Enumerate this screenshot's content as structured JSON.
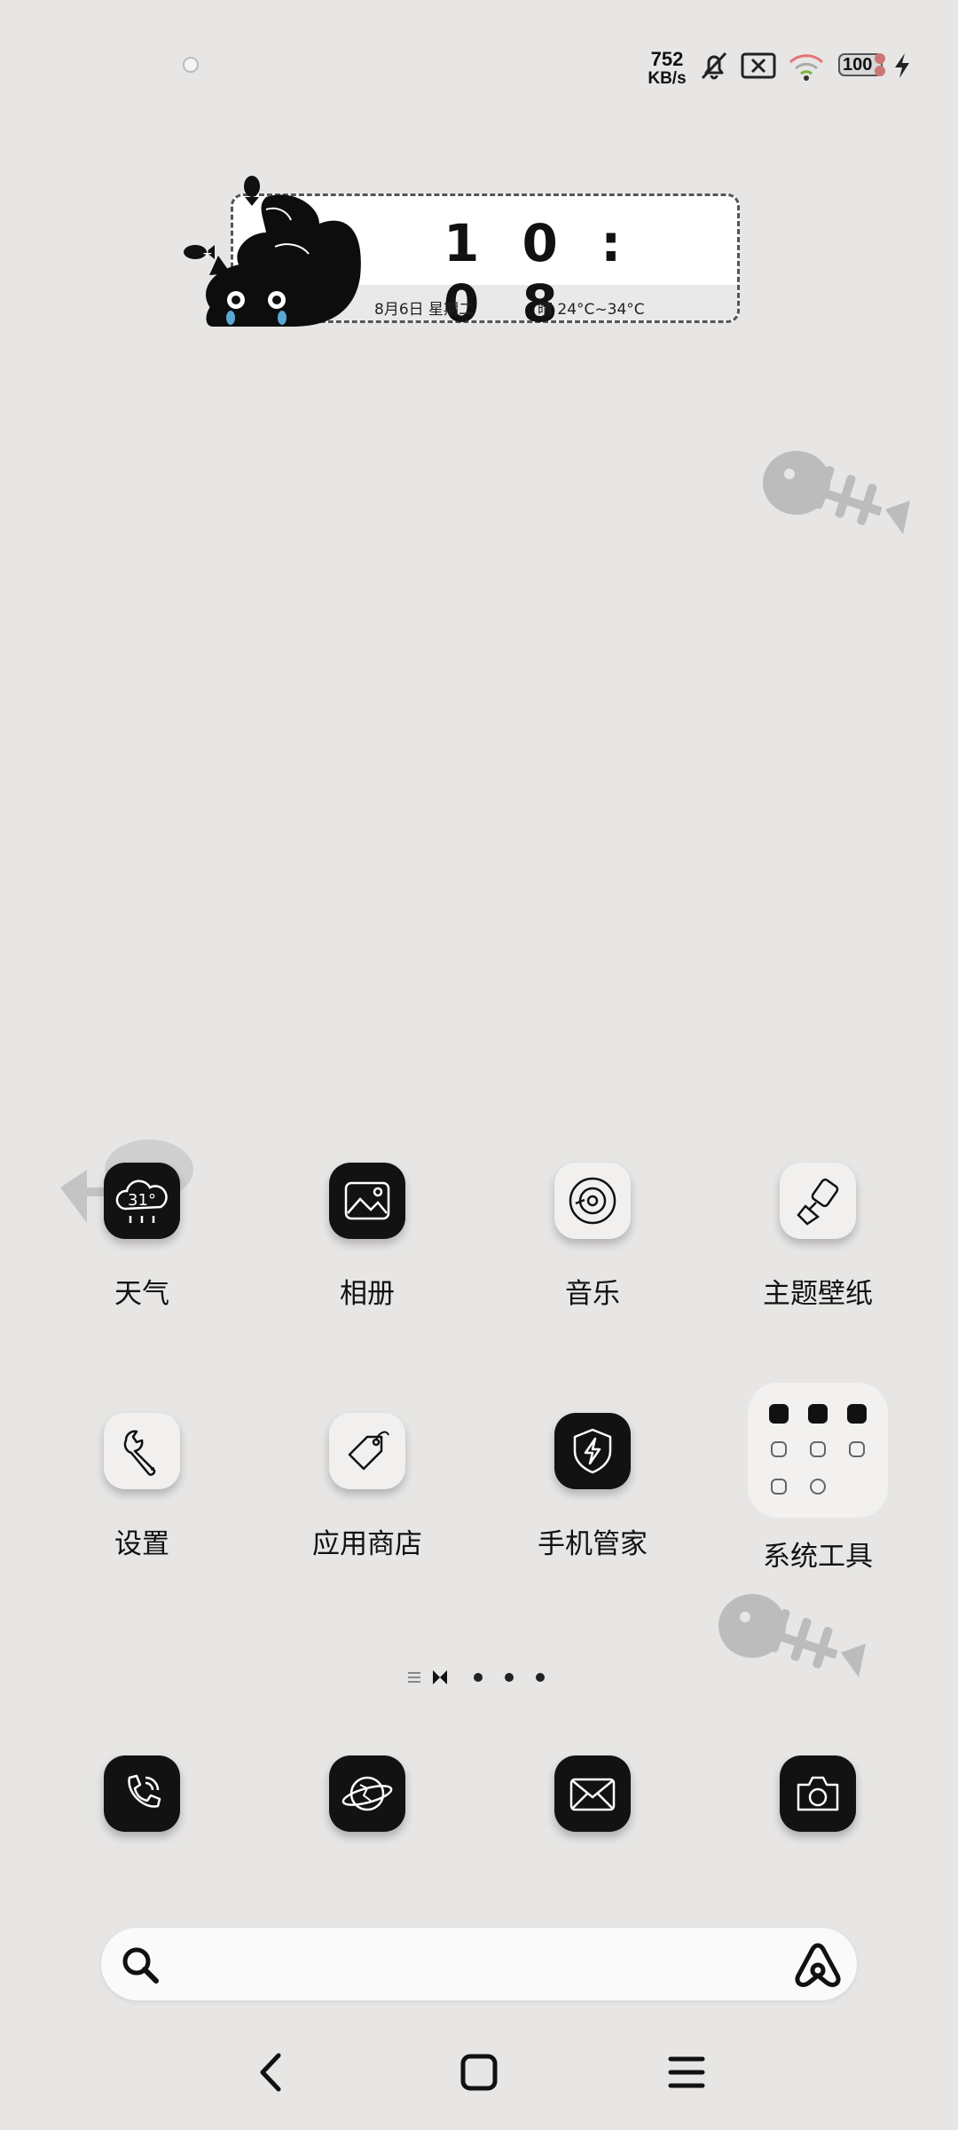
{
  "status_bar": {
    "net_speed_value": "752",
    "net_speed_unit": "KB/s",
    "battery_level": "100",
    "icons": [
      "notification-dot-icon",
      "mute-bell-icon",
      "no-sim-icon",
      "wifi-icon",
      "battery-icon",
      "charging-bolt-icon"
    ]
  },
  "clock_widget": {
    "time": "1 0 : 0 8",
    "date": "8月6日 星期二",
    "weather": "晴 24°C~34°C"
  },
  "apps": [
    {
      "label": "天气",
      "icon": "weather-cloud-icon",
      "badge": "31°"
    },
    {
      "label": "相册",
      "icon": "gallery-image-icon"
    },
    {
      "label": "音乐",
      "icon": "music-disc-icon"
    },
    {
      "label": "主题壁纸",
      "icon": "paint-brush-icon"
    },
    {
      "label": "设置",
      "icon": "wrench-icon"
    },
    {
      "label": "应用商店",
      "icon": "price-tag-icon"
    },
    {
      "label": "手机管家",
      "icon": "shield-bolt-icon"
    },
    {
      "label": "系统工具",
      "icon": "folder-icon"
    }
  ],
  "pager": {
    "current": 1,
    "total": 3
  },
  "dock": [
    {
      "icon": "phone-icon"
    },
    {
      "icon": "browser-globe-icon"
    },
    {
      "icon": "mail-icon"
    },
    {
      "icon": "camera-icon"
    }
  ],
  "search": {
    "placeholder": ""
  },
  "nav": [
    "back-icon",
    "home-icon",
    "menu-icon"
  ],
  "colors": {
    "background": "#e7e6e5",
    "icon_dark": "#121212",
    "icon_light": "#f1f0ef",
    "accent_blue": "#5aa7d6"
  }
}
